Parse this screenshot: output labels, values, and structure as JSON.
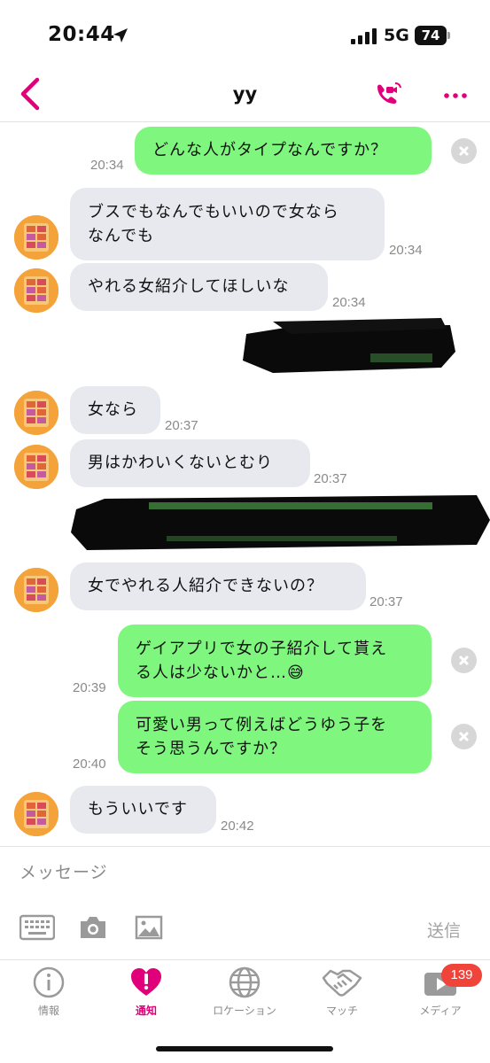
{
  "status_bar": {
    "time": "20:44",
    "network": "5G",
    "battery": "74"
  },
  "header": {
    "title": "yy"
  },
  "messages": [
    {
      "side": "out",
      "lines": [
        "どんな人がタイプなんですか？"
      ],
      "time": "20:34"
    },
    {
      "side": "in",
      "lines": [
        "ブスでもなんでもいいので女なら",
        "なんでも"
      ],
      "time": "20:34"
    },
    {
      "side": "in",
      "lines": [
        "やれる女紹介してほしいな"
      ],
      "time": "20:34"
    },
    {
      "side": "in",
      "lines": [
        "女なら"
      ],
      "time": "20:37"
    },
    {
      "side": "in",
      "lines": [
        "男はかわいくないとむり"
      ],
      "time": "20:37"
    },
    {
      "side": "in",
      "lines": [
        "女でやれる人紹介できないの？"
      ],
      "time": "20:37"
    },
    {
      "side": "out",
      "lines": [
        "ゲイアプリで女の子紹介して貰え",
        "る人は少ないかと…😅"
      ],
      "time": "20:39"
    },
    {
      "side": "out",
      "lines": [
        "可愛い男って例えばどうゆう子を",
        "そう思うんですか？"
      ],
      "time": "20:40"
    },
    {
      "side": "in",
      "lines": [
        "もういいです"
      ],
      "time": "20:42"
    }
  ],
  "input": {
    "placeholder": "メッセージ",
    "send_label": "送信"
  },
  "tabs": [
    {
      "label": "情報",
      "icon": "info-icon"
    },
    {
      "label": "通知",
      "icon": "heart-alert-icon"
    },
    {
      "label": "ロケーション",
      "icon": "globe-icon"
    },
    {
      "label": "マッチ",
      "icon": "handshake-icon"
    },
    {
      "label": "メディア",
      "icon": "play-icon"
    }
  ],
  "media_badge": "139",
  "colors": {
    "accent": "#e0007a",
    "outgoing_bubble": "#7ff77f",
    "incoming_bubble": "#e7e9ee",
    "badge": "#f0433a"
  }
}
